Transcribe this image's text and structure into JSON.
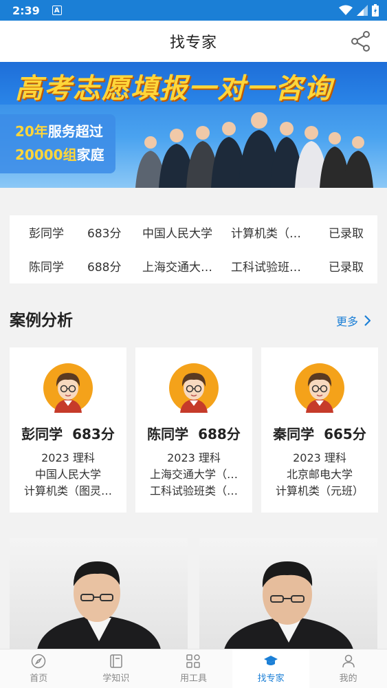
{
  "status_bar": {
    "time": "2:39",
    "a_icon": "A"
  },
  "header": {
    "title": "找专家"
  },
  "banner": {
    "headline": "高考志愿填报一对一咨询",
    "line1_highlight": "20年",
    "line1_text": "服务超过",
    "line2_highlight": "20000组",
    "line2_text": "家庭"
  },
  "admissions": [
    {
      "name": "彭同学",
      "score": "683分",
      "university": "中国人民大学",
      "major": "计算机类（…",
      "status": "已录取"
    },
    {
      "name": "陈同学",
      "score": "688分",
      "university": "上海交通大…",
      "major": "工科试验班…",
      "status": "已录取"
    }
  ],
  "case_section": {
    "title": "案例分析",
    "more": "更多"
  },
  "cases": [
    {
      "name": "彭同学",
      "score": "683分",
      "year_track": "2023 理科",
      "university": "中国人民大学",
      "major": "计算机类（图灵…"
    },
    {
      "name": "陈同学",
      "score": "688分",
      "year_track": "2023 理科",
      "university": "上海交通大学（…",
      "major": "工科试验班类（…"
    },
    {
      "name": "秦同学",
      "score": "665分",
      "year_track": "2023 理科",
      "university": "北京邮电大学",
      "major": "计算机类（元班）"
    }
  ],
  "bottom_nav": [
    {
      "label": "首页",
      "icon": "compass-icon"
    },
    {
      "label": "学知识",
      "icon": "book-icon"
    },
    {
      "label": "用工具",
      "icon": "tools-icon"
    },
    {
      "label": "找专家",
      "icon": "graduation-cap-icon",
      "active": true
    },
    {
      "label": "我的",
      "icon": "user-icon"
    }
  ],
  "colors": {
    "primary": "#1b7fd6",
    "banner_yellow": "#ffd63a",
    "avatar_orange": "#f4a21a"
  }
}
